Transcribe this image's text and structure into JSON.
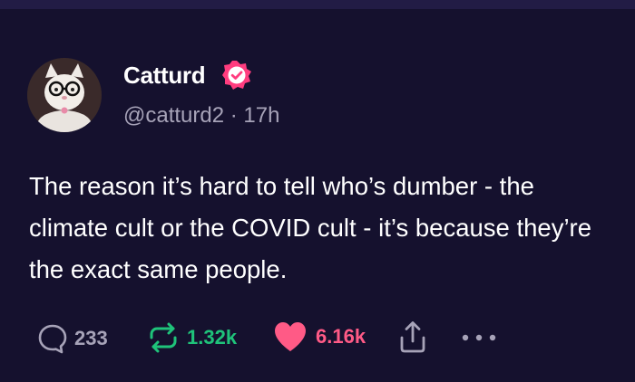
{
  "author": {
    "display_name": "Catturd",
    "handle": "@catturd2",
    "separator": " · ",
    "time_ago": "17h",
    "verified": true
  },
  "tweet": {
    "text": "The reason it’s hard to tell who’s dumber - the climate cult or the COVID cult - it’s because they’re the exact same people."
  },
  "actions": {
    "replies": "233",
    "retweets": "1.32k",
    "likes": "6.16k"
  },
  "colors": {
    "background": "#15112e",
    "verified_badge": "#ff3d7f",
    "retweet": "#1fc37a",
    "like": "#ff5a86",
    "muted": "#a7a3b8"
  },
  "icons": [
    "reply-icon",
    "retweet-icon",
    "heart-icon",
    "share-icon",
    "more-icon",
    "verified-badge-icon"
  ]
}
